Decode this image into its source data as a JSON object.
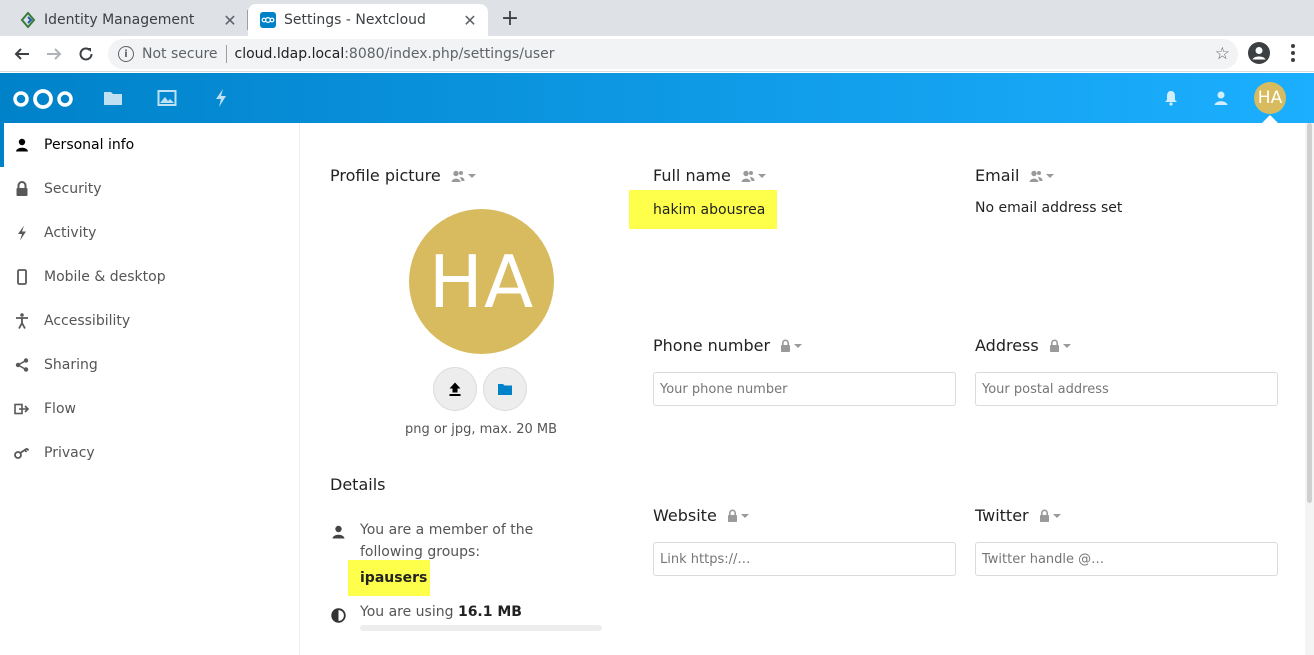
{
  "browser": {
    "tabs": [
      {
        "title": "Identity Management",
        "active": false,
        "icon": "idm-favicon"
      },
      {
        "title": "Settings - Nextcloud",
        "active": true,
        "icon": "nextcloud-favicon"
      }
    ],
    "security_label": "Not secure",
    "url_host": "cloud.ldap.local",
    "url_path": ":8080/index.php/settings/user"
  },
  "header": {
    "brand_color": "#0082c9",
    "apps": [
      "files-icon",
      "photos-icon",
      "activity-icon"
    ],
    "avatar_initials": "HA",
    "avatar_color": "#d8bb5e"
  },
  "sidebar": {
    "items": [
      {
        "label": "Personal info",
        "icon": "person-icon",
        "active": true
      },
      {
        "label": "Security",
        "icon": "lock-icon",
        "active": false
      },
      {
        "label": "Activity",
        "icon": "lightning-icon",
        "active": false
      },
      {
        "label": "Mobile & desktop",
        "icon": "phone-icon",
        "active": false
      },
      {
        "label": "Accessibility",
        "icon": "accessibility-icon",
        "active": false
      },
      {
        "label": "Sharing",
        "icon": "share-icon",
        "active": false
      },
      {
        "label": "Flow",
        "icon": "flow-icon",
        "active": false
      },
      {
        "label": "Privacy",
        "icon": "key-icon",
        "active": false
      }
    ]
  },
  "profile": {
    "picture_title": "Profile picture",
    "avatar_initials": "HA",
    "hint": "png or jpg, max. 20 MB",
    "details_title": "Details",
    "groups_text": "You are a member of the following groups:",
    "group": "ipausers",
    "quota_prefix": "You are using",
    "quota_value": "16.1 MB",
    "quota_fraction": 0.0
  },
  "fields": {
    "fullname_label": "Full name",
    "fullname_value": "hakim abousrea",
    "email_label": "Email",
    "email_value": "No email address set",
    "phone_label": "Phone number",
    "phone_placeholder": "Your phone number",
    "address_label": "Address",
    "address_placeholder": "Your postal address",
    "website_label": "Website",
    "website_placeholder": "Link https://…",
    "twitter_label": "Twitter",
    "twitter_placeholder": "Twitter handle @…"
  },
  "highlight_color": "#feff4b"
}
